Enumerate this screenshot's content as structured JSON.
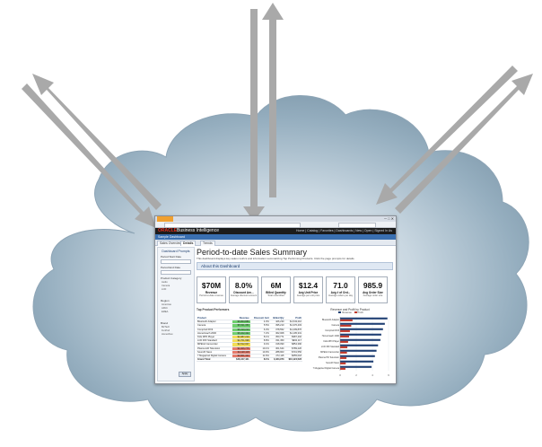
{
  "window": {
    "brand": "ORACLE",
    "product": "Business Intelligence",
    "dashboard_name": "Sample Dashboard",
    "tabs": [
      "Sales Overview",
      "Details",
      "Trends"
    ],
    "url": "",
    "menu": "Home | Catalog | Favorites | Dashboards | New | Open | Signed In As"
  },
  "prompts": {
    "title": "Dashboard Prompts",
    "fields": [
      {
        "label": "Period Start Date",
        "value": "1/1/2008"
      },
      {
        "label": "Period End Date",
        "value": "12/31/2008"
      },
      {
        "label": "Product Category",
        "options": [
          "Audio",
          "Camera",
          "LCD",
          "Plasma"
        ]
      },
      {
        "label": "Region",
        "options": [
          "Americas",
          "APAC",
          "EMEA"
        ]
      },
      {
        "label": "Brand",
        "options": [
          "BizTech",
          "FunPod",
          "HomeView"
        ]
      }
    ],
    "apply_label": "Apply"
  },
  "page": {
    "title": "Period-to-date Sales Summary",
    "description": "This dashboard displays key sales metrics and information summarizing Top Performing Products. Click the page prompts for details.",
    "section_title": "About this Dashboard"
  },
  "kpis": [
    {
      "value": "$70M",
      "name": "Revenue",
      "desc": "Period-to-date revenue"
    },
    {
      "value": "8.0%",
      "name": "Discount Am...",
      "desc": "Average discount amount"
    },
    {
      "value": "6M",
      "name": "Billed Quantity",
      "desc": "Total units billed"
    },
    {
      "value": "$12.4",
      "name": "Avg Unit Price",
      "desc": "Average per unit price"
    },
    {
      "value": "71.0",
      "name": "Avg # of Ord...",
      "desc": "Average orders per day"
    },
    {
      "value": "985.9",
      "name": "Avg Order Size",
      "desc": "Average order size"
    }
  ],
  "table": {
    "title": "Top Product Performers",
    "columns": [
      "Product",
      "Revenue",
      "Discount Amt",
      "Billed Qty",
      "Profit"
    ],
    "rows": [
      {
        "cells": [
          "Bluetooth Adaptor",
          "$5,863,886",
          "4.0%",
          "426,230",
          "$1,543,210"
        ],
        "status": "g"
      },
      {
        "cells": [
          "Camera",
          "$5,541,350",
          "5.5%",
          "395,210",
          "$1,376,403"
        ],
        "status": "g"
      },
      {
        "cells": [
          "CompCell RX3",
          "$5,310,213",
          "6.3%",
          "378,552",
          "$1,209,876"
        ],
        "status": "g"
      },
      {
        "cells": [
          "HomeCoach 2000",
          "$5,102,432",
          "7.2%",
          "362,008",
          "$1,105,331"
        ],
        "status": "g"
      },
      {
        "cells": [
          "Kids MP3 Player",
          "$4,987,210",
          "8.1%",
          "350,771",
          "$987,402"
        ],
        "status": "y"
      },
      {
        "cells": [
          "LCD 36X Standard",
          "$4,701,998",
          "8.8%",
          "331,450",
          "$902,117"
        ],
        "status": "y"
      },
      {
        "cells": [
          "MPEG4 Camcorder",
          "$4,512,007",
          "9.4%",
          "318,090",
          "$854,390"
        ],
        "status": "y"
      },
      {
        "cells": [
          "Plasma HD Television",
          "$4,306,775",
          "10.1%",
          "301,644",
          "$789,220"
        ],
        "status": "r"
      },
      {
        "cells": [
          "SoundX Nano",
          "$4,120,118",
          "10.9%",
          "288,903",
          "$701,556"
        ],
        "status": "r"
      },
      {
        "cells": [
          "7 Megapixel Digital Camera",
          "$3,901,442",
          "11.6%",
          "272,115",
          "$655,018"
        ],
        "status": "r"
      }
    ],
    "total": [
      "Grand Total",
      "$48,347,431",
      "8.1%",
      "3,424,973",
      "$10,124,523"
    ]
  },
  "chart_data": {
    "type": "bar",
    "orientation": "horizontal",
    "title": "Revenue and Profit by Product",
    "categories": [
      "Bluetooth Adaptor",
      "Camera",
      "CompCell RX3",
      "HomeCoach 2000",
      "Kids MP3 Player",
      "LCD 36X Standard",
      "MPEG4 Camcorder",
      "Plasma HD Television",
      "SoundX Nano",
      "7 Megapixel Digital Camera"
    ],
    "series": [
      {
        "name": "Revenue",
        "color": "#1f3f73",
        "values": [
          5.86,
          5.54,
          5.31,
          5.1,
          4.99,
          4.7,
          4.51,
          4.31,
          4.12,
          3.9
        ]
      },
      {
        "name": "Profit",
        "color": "#c0392b",
        "values": [
          1.54,
          1.38,
          1.21,
          1.11,
          0.99,
          0.9,
          0.85,
          0.79,
          0.7,
          0.66
        ]
      }
    ],
    "xlim": [
      0,
      6
    ],
    "grid": true,
    "legend": "top"
  },
  "colors": {
    "arrow": "#a9a9a9",
    "cloud_light": "#eef3f7",
    "cloud_dark": "#7b96a8"
  }
}
